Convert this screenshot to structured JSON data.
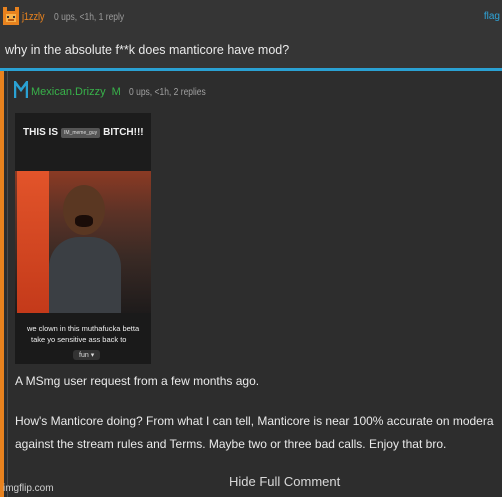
{
  "top_comment": {
    "username": "j1zzly",
    "meta": "0 ups, <1h, 1 reply",
    "flag_label": "flag",
    "text": "why in the absolute f**k does manticore have mod?",
    "colors": {
      "username": "#e8821e",
      "divider": "#2aa1d3"
    }
  },
  "reply": {
    "username": "Mexican.Drizzy",
    "badge": "M",
    "meta": "0 ups, <1h, 2 replies",
    "meme": {
      "title_left": "THIS IS",
      "title_chip": "IM_meme_guy",
      "title_right": "BITCH!!!",
      "caption_line1": "we clown in this muthafucka betta",
      "caption_line2": "take yo sensitive ass back to",
      "button": "fun"
    },
    "line1": "A MSmg user request from a few months ago.",
    "line2": "How's Manticore doing? From what I can tell, Manticore is near 100% accurate on modera",
    "line3": "against the stream rules and Terms. Maybe two or three bad calls. Enjoy that bro.",
    "hide_label": "Hide Full Comment",
    "colors": {
      "username": "#38b24a",
      "left_bar": "#e8821e"
    }
  },
  "watermark": "imgflip.com",
  "icons": {
    "top_avatar": "orange-face-icon",
    "reply_avatar": "blue-m-icon",
    "dropdown": "caret-down-icon"
  }
}
